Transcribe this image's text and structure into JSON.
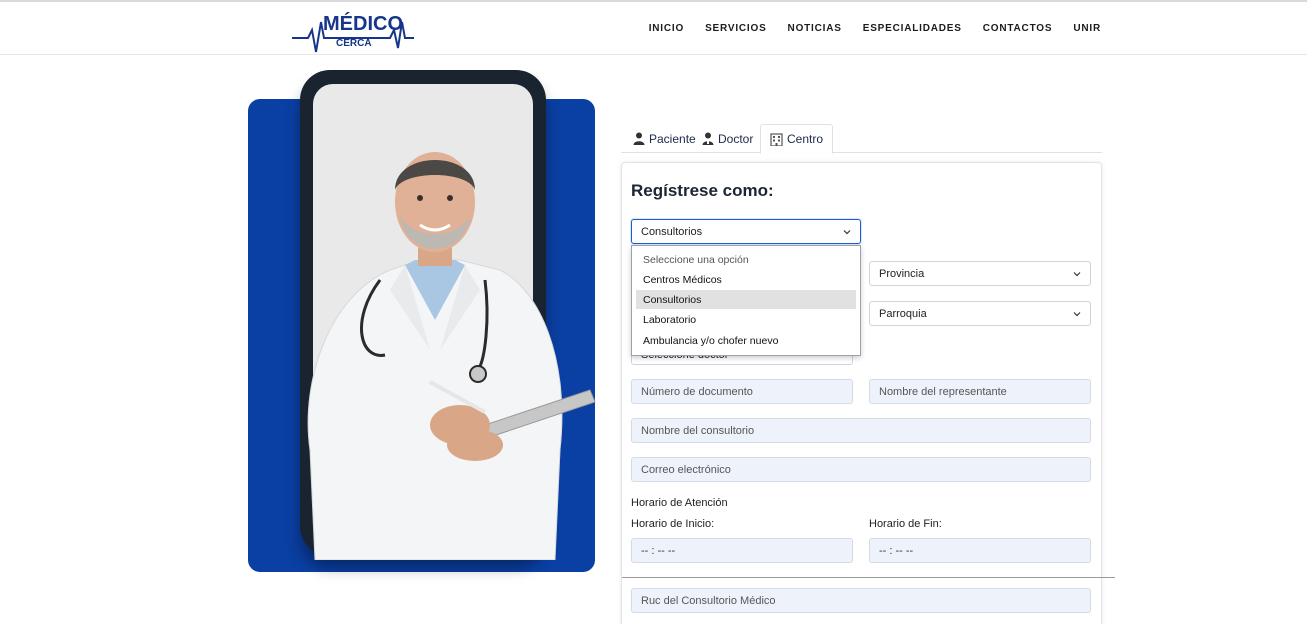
{
  "brand": {
    "logo_top": "MÉDICO",
    "logo_bottom": "CERCA",
    "color": "#17358c"
  },
  "nav": {
    "items": [
      {
        "label": "INICIO"
      },
      {
        "label": "SERVICIOS"
      },
      {
        "label": "NOTICIAS"
      },
      {
        "label": "ESPECIALIDADES"
      },
      {
        "label": "CONTACTOS"
      },
      {
        "label": "UNIR"
      }
    ]
  },
  "tabs": [
    {
      "label": "Paciente",
      "icon": "user-icon",
      "active": false
    },
    {
      "label": "Doctor",
      "icon": "doctor-icon",
      "active": false
    },
    {
      "label": "Centro",
      "icon": "building-icon",
      "active": true
    }
  ],
  "form": {
    "title": "Regístrese como:",
    "type_select": {
      "value": "Consultorios",
      "options": [
        "Seleccione una opción",
        "Centros Médicos",
        "Consultorios",
        "Laboratorio",
        "Ambulancia y/o chofer nuevo"
      ],
      "highlighted": "Consultorios"
    },
    "provincia": "Provincia",
    "parroquia": "Parroquia",
    "doctor_select_partial": "Seleccione doctor",
    "numero_documento": "Número de documento",
    "nombre_representante": "Nombre del representante",
    "nombre_consultorio": "Nombre del consultorio",
    "correo": "Correo electrónico",
    "horario_label": "Horario de Atención",
    "inicio_label": "Horario de Inicio:",
    "fin_label": "Horario de Fin:",
    "inicio_value": "-- : --   --",
    "fin_value": "-- : --   --",
    "ruc": "Ruc del Consultorio Médico"
  },
  "colors": {
    "hero_blue": "#0a3fa3",
    "input_bg": "#eef3fb",
    "focus_border": "#1e5bd8"
  }
}
